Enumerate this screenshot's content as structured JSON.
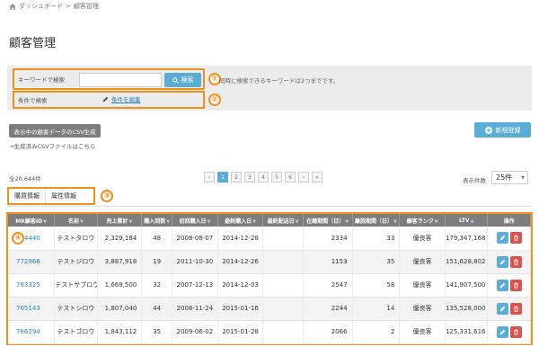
{
  "breadcrumb": {
    "home": "ダッシュボード",
    "separator": ">",
    "current": "顧客管理"
  },
  "page_title": "顧客管理",
  "search": {
    "keyword_label": "キーワードで検索",
    "keyword_value": "",
    "button_label": "検索",
    "hint": "同時に検索できるキーワードは2つまでです。",
    "condition_label": "条件で検索",
    "condition_link": "条件を編集"
  },
  "csv": {
    "button_label": "表示中の顧客データのCSV生成",
    "note": "→生成済みCSVファイルはこちら"
  },
  "new_button_label": "新規登録",
  "total_count": "全20,644件",
  "pagination": {
    "prev": "‹",
    "pages": [
      "1",
      "2",
      "3",
      "4",
      "5",
      "6"
    ],
    "next": "›",
    "last": "»",
    "current": "1"
  },
  "per_page": {
    "label": "表示件数",
    "value": "25件"
  },
  "tabs": [
    "購買情報",
    "属性情報"
  ],
  "markers": [
    "①",
    "②",
    "③",
    "④"
  ],
  "colors": {
    "accent": "#5aaed6",
    "highlight": "#f0901e",
    "danger": "#d9534f",
    "header": "#7d7d7d",
    "link": "#2b80c0"
  },
  "table": {
    "columns": [
      "MR顧客ID",
      "名前",
      "売上累計",
      "購入回数",
      "初回購入日",
      "最終購入日",
      "最終配送日",
      "在籍期間（日）",
      "離脱期間（日）",
      "顧客ランク",
      "LTV",
      "操作"
    ],
    "rows": [
      [
        "774440",
        "テストタロウ",
        "2,329,184",
        "48",
        "2008-08-07",
        "2014-12-28",
        "",
        "2334",
        "33",
        "優良客",
        "179,347,168"
      ],
      [
        "772968",
        "テストジロウ",
        "3,887,918",
        "19",
        "2011-10-30",
        "2014-12-26",
        "",
        "1153",
        "35",
        "優良客",
        "151,628,802"
      ],
      [
        "763325",
        "テストサブロウ",
        "1,669,500",
        "32",
        "2007-12-13",
        "2014-12-03",
        "",
        "2547",
        "58",
        "優良客",
        "141,907,500"
      ],
      [
        "765143",
        "テストシロウ",
        "1,807,040",
        "44",
        "2008-11-24",
        "2015-01-16",
        "",
        "2244",
        "14",
        "優良客",
        "135,528,000"
      ],
      [
        "766294",
        "テストゴロウ",
        "1,843,112",
        "35",
        "2009-06-02",
        "2015-01-28",
        "",
        "2066",
        "2",
        "優良客",
        "125,331,616"
      ]
    ]
  }
}
